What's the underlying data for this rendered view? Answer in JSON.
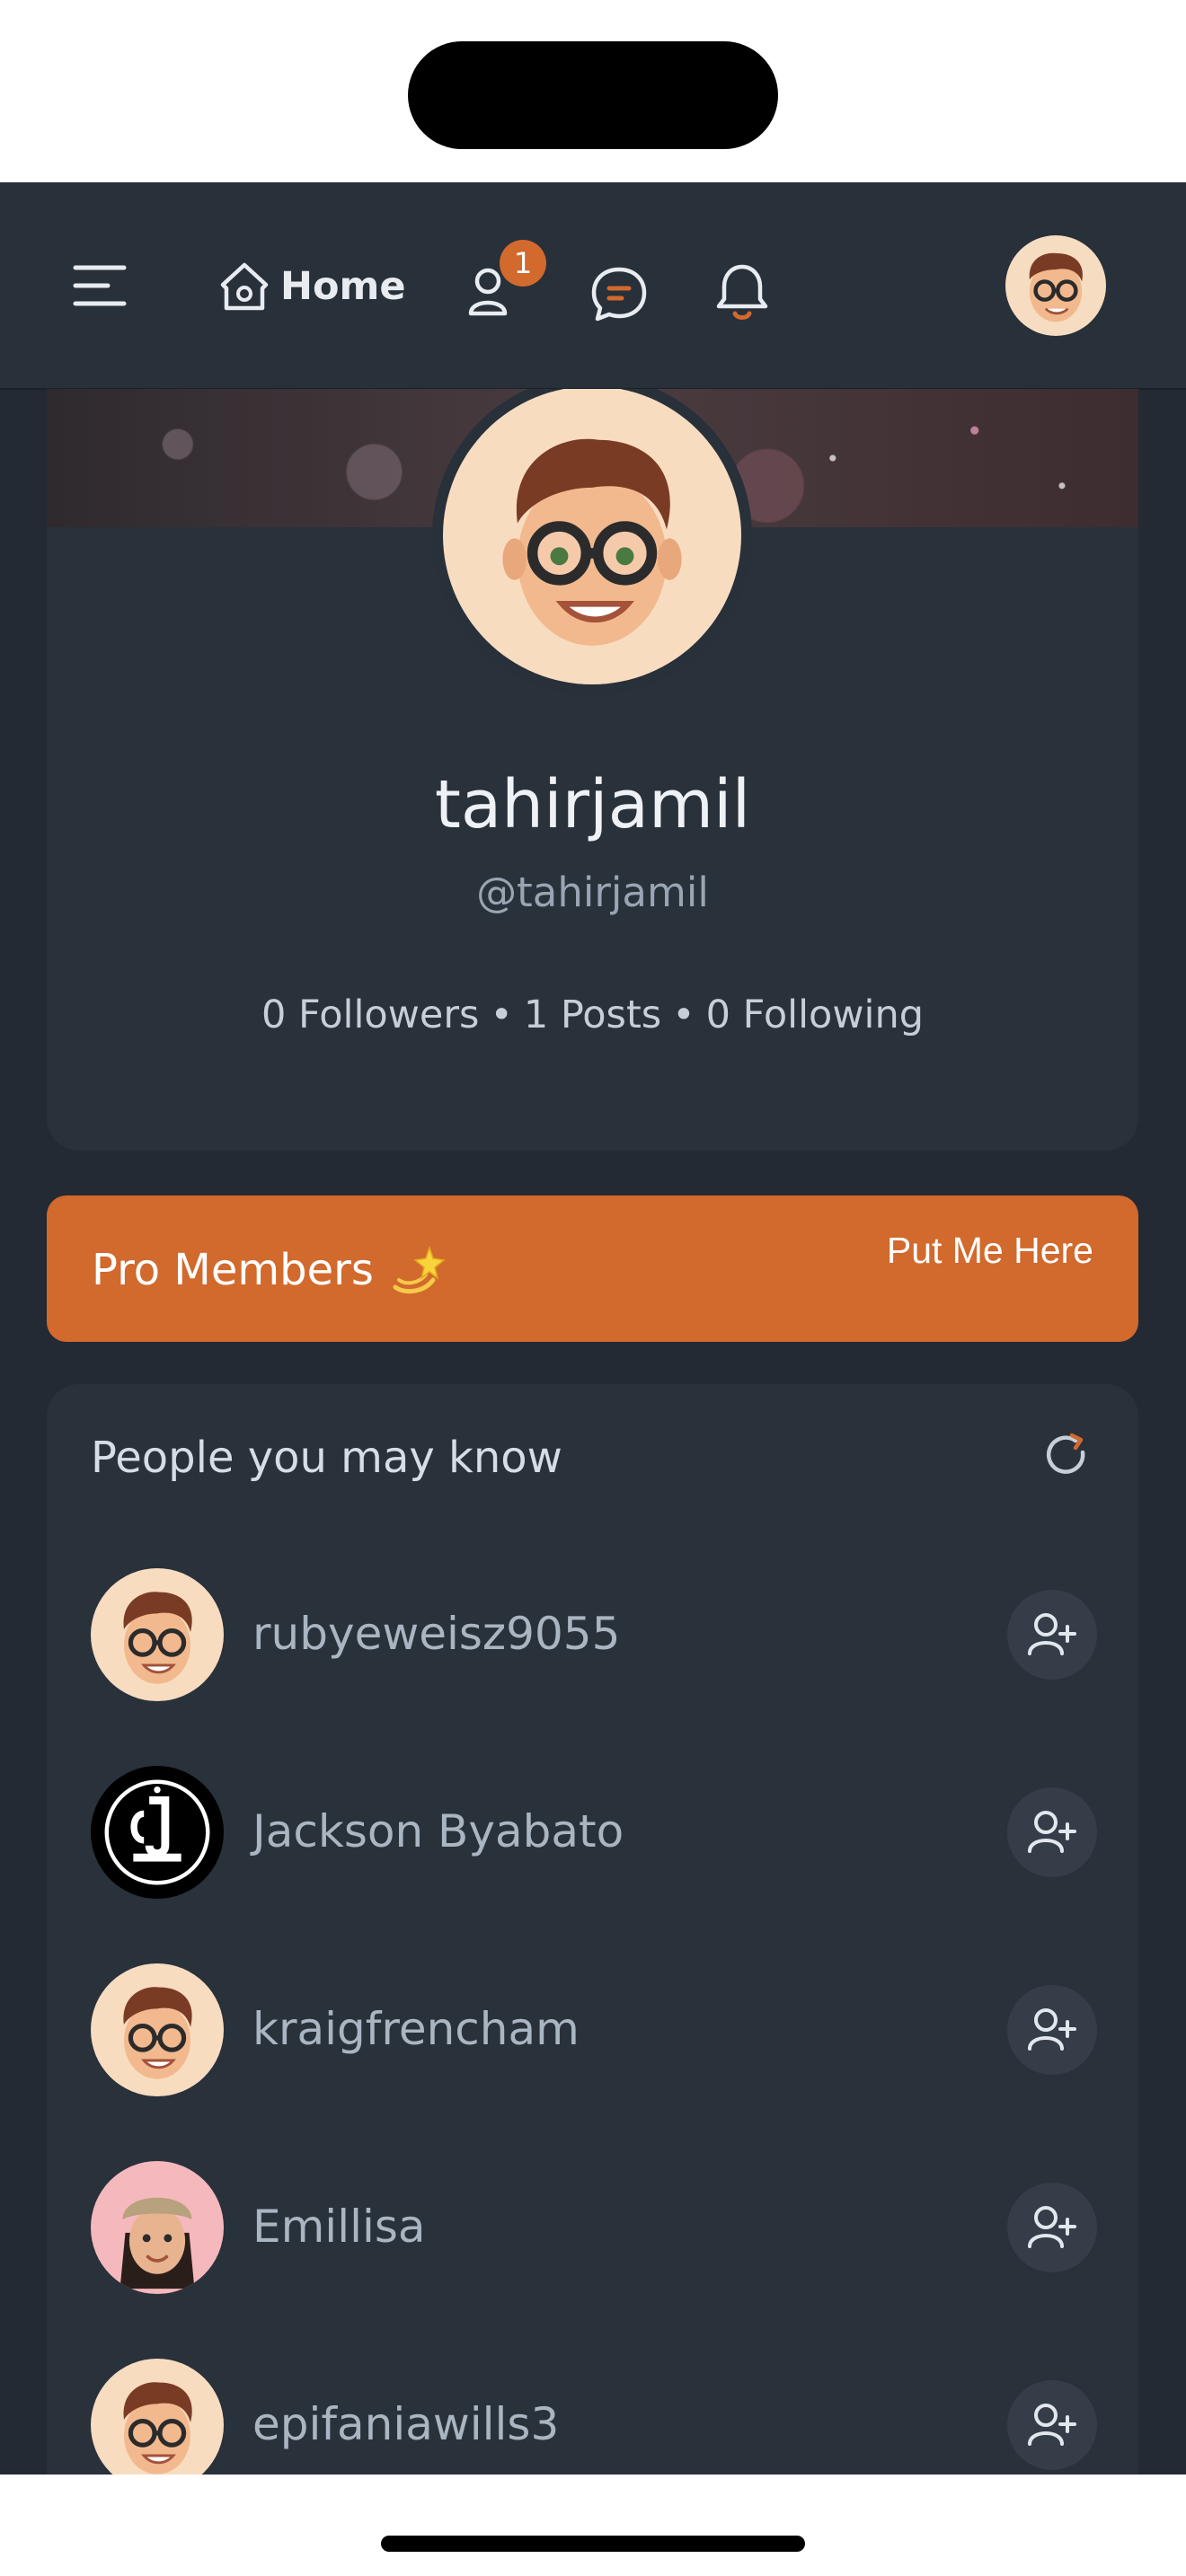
{
  "nav": {
    "home_label": "Home",
    "friend_requests_count": "1"
  },
  "profile": {
    "display_name": "tahirjamil",
    "handle": "@tahirjamil",
    "followers": "0 Followers",
    "posts": "1 Posts",
    "following": "0 Following",
    "separator": "•"
  },
  "pro_banner": {
    "label": "Pro Members",
    "action": "Put Me Here"
  },
  "people": {
    "title": "People you may know",
    "items": [
      {
        "name": "rubyeweisz9055",
        "avatar": "memoji-glasses"
      },
      {
        "name": "Jackson Byabato",
        "avatar": "barracks-logo"
      },
      {
        "name": "kraigfrencham",
        "avatar": "memoji-glasses"
      },
      {
        "name": "Emillisa",
        "avatar": "memoji-hat"
      },
      {
        "name": "epifaniawills3",
        "avatar": "memoji-glasses"
      }
    ]
  },
  "colors": {
    "background": "#232a33",
    "card": "#29313b",
    "accent": "#d2692d",
    "text_primary": "#eef1f5",
    "text_muted": "#9aa5b3"
  },
  "icons": [
    "menu-icon",
    "home-icon",
    "user-icon",
    "chat-icon",
    "bell-icon",
    "refresh-icon",
    "add-user-icon",
    "dizzy-emoji"
  ]
}
